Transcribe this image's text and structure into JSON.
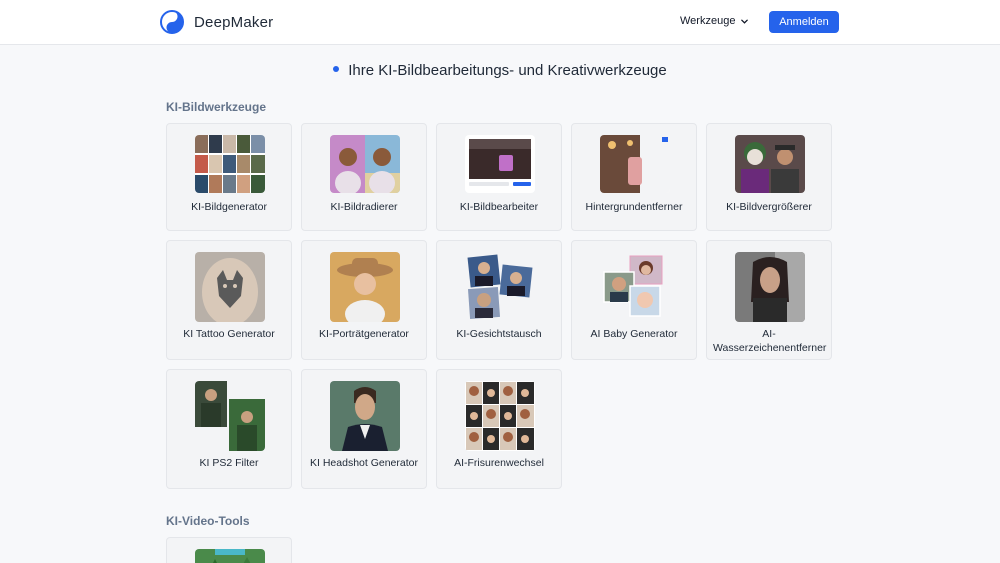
{
  "header": {
    "brand": "DeepMaker",
    "tools_menu": "Werkzeuge",
    "login_label": "Anmelden",
    "accent_color": "#2563eb"
  },
  "main": {
    "heading": "Ihre KI-Bildbearbeitungs- und Kreativwerkzeuge",
    "sections": [
      {
        "title": "KI-Bildwerkzeuge",
        "tools": [
          {
            "label": "KI-Bildgenerator",
            "icon": "image-grid-thumbnail"
          },
          {
            "label": "KI-Bildradierer",
            "icon": "portrait-pair-thumbnail"
          },
          {
            "label": "KI-Bildbearbeiter",
            "icon": "editor-screen-thumbnail"
          },
          {
            "label": "Hintergrundentferner",
            "icon": "cafe-scene-thumbnail"
          },
          {
            "label": "KI-Bildvergrößerer",
            "icon": "joker-portrait-thumbnail"
          },
          {
            "label": "KI Tattoo Generator",
            "icon": "back-tattoo-thumbnail"
          },
          {
            "label": "KI-Porträtgenerator",
            "icon": "hat-portrait-thumbnail"
          },
          {
            "label": "KI-Gesichtstausch",
            "icon": "face-swap-thumbnail"
          },
          {
            "label": "AI Baby Generator",
            "icon": "baby-collage-thumbnail"
          },
          {
            "label": "AI-Wasserzeichenentferner",
            "icon": "woman-portrait-thumbnail"
          },
          {
            "label": "KI PS2 Filter",
            "icon": "forest-portrait-thumbnail"
          },
          {
            "label": "KI Headshot Generator",
            "icon": "headshot-thumbnail"
          },
          {
            "label": "AI-Frisurenwechsel",
            "icon": "hairstyle-grid-thumbnail"
          }
        ]
      },
      {
        "title": "KI-Video-Tools",
        "tools": []
      }
    ]
  }
}
